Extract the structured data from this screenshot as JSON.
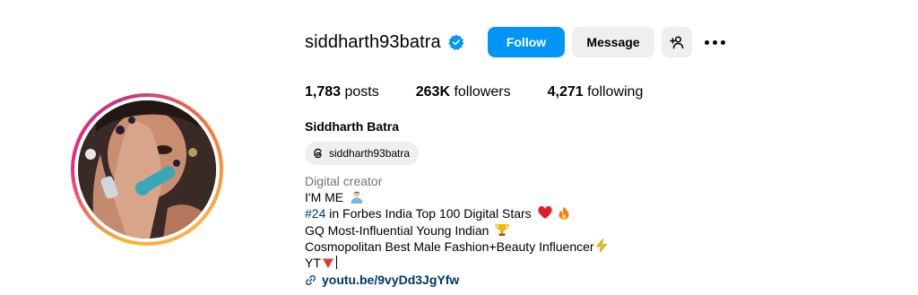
{
  "profile": {
    "username": "siddharth93batra",
    "verified": true,
    "full_name": "Siddharth Batra",
    "threads_handle": "siddharth93batra"
  },
  "actions": {
    "follow_label": "Follow",
    "message_label": "Message"
  },
  "stats": {
    "posts_count": "1,783",
    "posts_label": "posts",
    "followers_count": "263K",
    "followers_label": "followers",
    "following_count": "4,271",
    "following_label": "following"
  },
  "bio": {
    "category": "Digital creator",
    "line1": "I'M ME",
    "line2_hashtag": "#24",
    "line2_text": " in Forbes India Top 100 Digital Stars",
    "line3": "GQ Most-Influential Young Indian",
    "line4": "Cosmopolitan Best Male Fashion+Beauty Influencer",
    "line5": "YT",
    "link": "youtu.be/9vyDd3JgYfw"
  },
  "colors": {
    "accent": "#0095f6",
    "link": "#00376b",
    "secondary_text": "#737373",
    "button_bg": "#efefef"
  }
}
